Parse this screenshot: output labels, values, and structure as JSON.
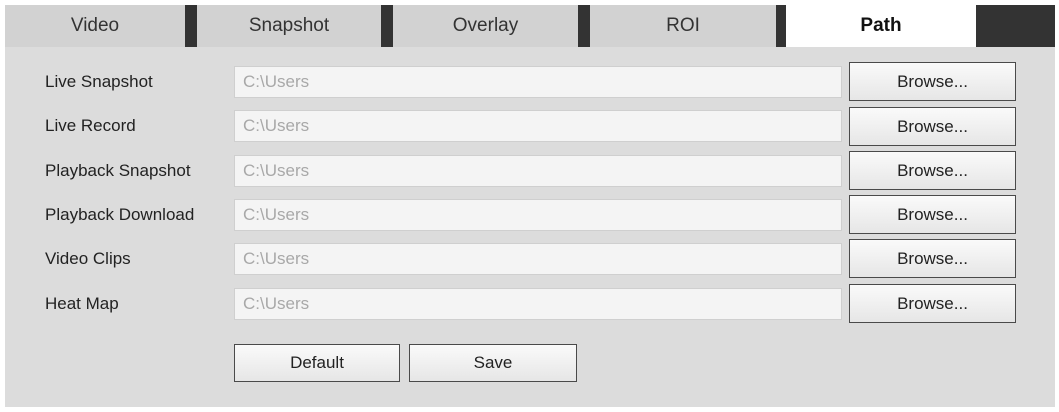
{
  "tabs": [
    {
      "label": "Video",
      "active": false
    },
    {
      "label": "Snapshot",
      "active": false
    },
    {
      "label": "Overlay",
      "active": false
    },
    {
      "label": "ROI",
      "active": false
    },
    {
      "label": "Path",
      "active": true
    }
  ],
  "rows": [
    {
      "label": "Live Snapshot",
      "value": "C:\\Users",
      "button": "Browse..."
    },
    {
      "label": "Live Record",
      "value": "C:\\Users",
      "button": "Browse..."
    },
    {
      "label": "Playback Snapshot",
      "value": "C:\\Users",
      "button": "Browse..."
    },
    {
      "label": "Playback Download",
      "value": "C:\\Users",
      "button": "Browse..."
    },
    {
      "label": "Video Clips",
      "value": "C:\\Users",
      "button": "Browse..."
    },
    {
      "label": "Heat Map",
      "value": "C:\\Users",
      "button": "Browse..."
    }
  ],
  "actions": {
    "default_label": "Default",
    "save_label": "Save"
  }
}
